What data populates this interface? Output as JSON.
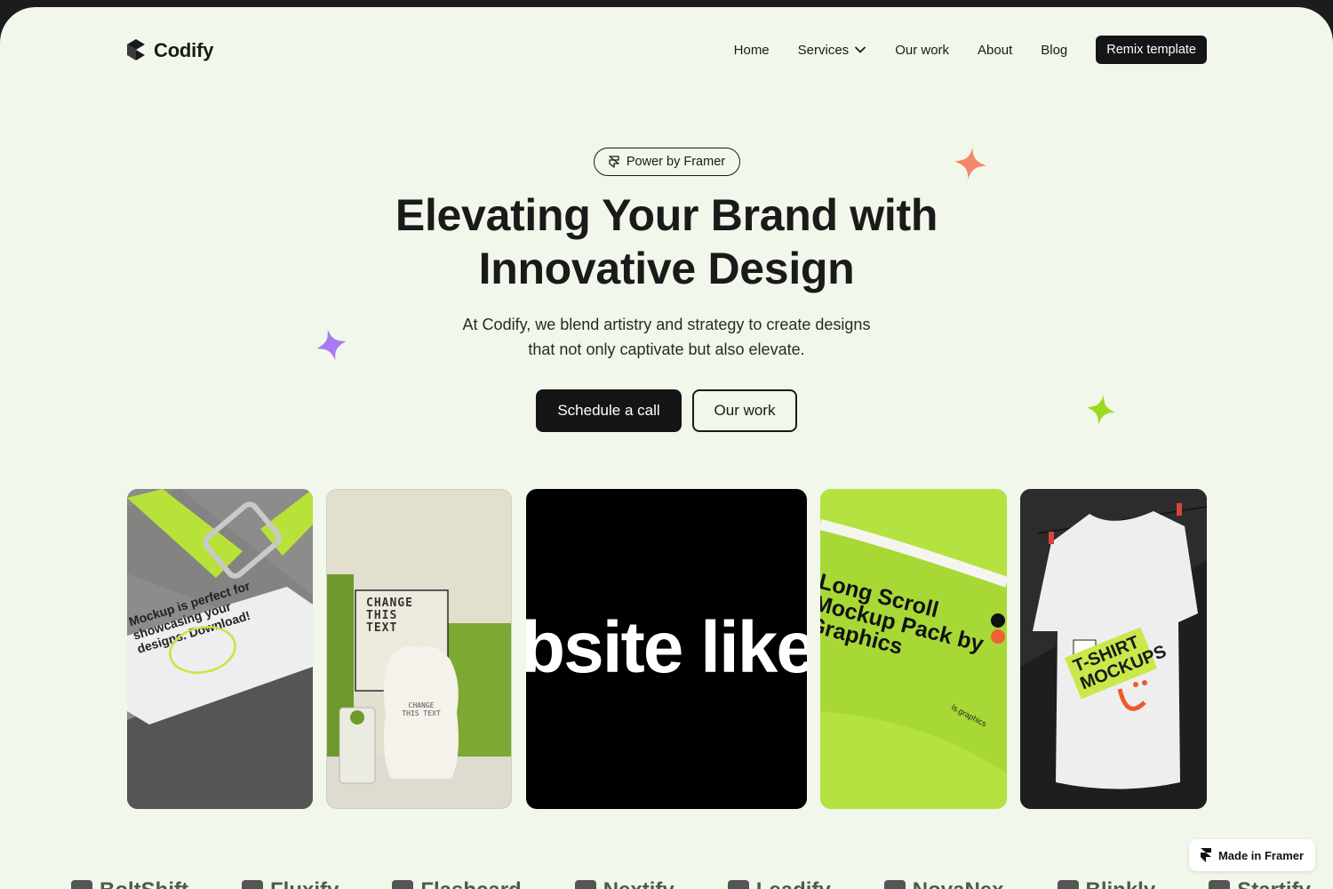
{
  "brand": {
    "name": "Codify"
  },
  "nav": {
    "items": [
      {
        "label": "Home"
      },
      {
        "label": "Services",
        "has_dropdown": true
      },
      {
        "label": "Our work"
      },
      {
        "label": "About"
      },
      {
        "label": "Blog"
      }
    ],
    "remix_label": "Remix template"
  },
  "hero": {
    "badge": "Power by Framer",
    "headline_line1": "Elevating Your Brand with",
    "headline_line2": "Innovative Design",
    "subtext_line1": "At Codify, we blend artistry and strategy to create designs",
    "subtext_line2": "that not only captivate but also elevate.",
    "cta_primary": "Schedule a call",
    "cta_secondary": "Our work"
  },
  "gallery": {
    "card1_text": "Mockup is perfect for showcasing your designs. Download!",
    "card2_text": "CHANGE THIS TEXT",
    "card2_bag_text": "CHANGE THIS TEXT",
    "card3_text": "bsite like",
    "card4_text": "Long Scroll Mockup Pack by Graphics",
    "card4_footer": "ls.graphics",
    "card5_text": "T-SHIRT MOCKUPS"
  },
  "logos": {
    "items": [
      "BoltShift",
      "Fluxify",
      "Flashcard",
      "Nextify",
      "Leadify",
      "NovaNex",
      "Blinkly",
      "Startify"
    ]
  },
  "footer_badge": "Made in Framer",
  "colors": {
    "background": "#f1f7ea",
    "dark": "#151515",
    "accent_lime": "#b0e33f",
    "sparkle_coral": "#f5876a",
    "sparkle_purple": "#a87bf0",
    "sparkle_green": "#9bdb1f"
  }
}
